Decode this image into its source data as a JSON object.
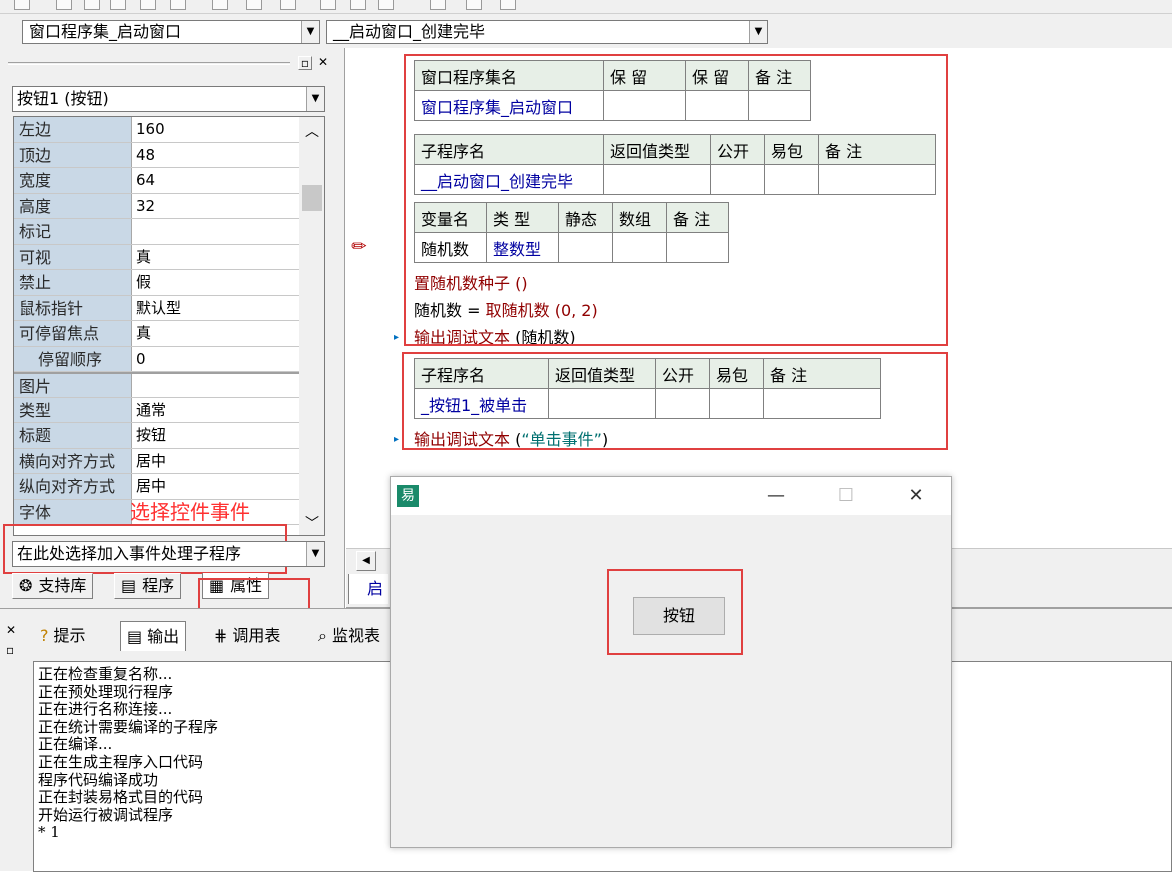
{
  "combos": {
    "assembly": "窗口程序集_启动窗口",
    "subroutine": "__启动窗口_创建完毕"
  },
  "properties": {
    "object": "按钮1 (按钮)",
    "rows": [
      {
        "name": "左边",
        "value": "160"
      },
      {
        "name": "顶边",
        "value": "48"
      },
      {
        "name": "宽度",
        "value": "64"
      },
      {
        "name": "高度",
        "value": "32"
      },
      {
        "name": "标记",
        "value": ""
      },
      {
        "name": "可视",
        "value": "真"
      },
      {
        "name": "禁止",
        "value": "假"
      },
      {
        "name": "鼠标指针",
        "value": "默认型"
      },
      {
        "name": "可停留焦点",
        "value": "真"
      },
      {
        "name": "停留顺序",
        "value": "0"
      },
      {
        "name": "图片",
        "value": ""
      },
      {
        "name": "类型",
        "value": "通常"
      },
      {
        "name": "标题",
        "value": "按钮"
      },
      {
        "name": "横向对齐方式",
        "value": "居中"
      },
      {
        "name": "纵向对齐方式",
        "value": "居中"
      },
      {
        "name": "字体",
        "value": ""
      }
    ],
    "event_combo": "在此处选择加入事件处理子程序",
    "select_hint": "选择控件事件"
  },
  "pane_tabs": {
    "support": "支持库",
    "program": "程序",
    "property": "属性"
  },
  "code": {
    "assembly_table": {
      "headers": [
        "窗口程序集名",
        "保 留",
        "保 留",
        "备 注"
      ],
      "row": [
        "窗口程序集_启动窗口",
        "",
        "",
        ""
      ]
    },
    "sub1_table": {
      "headers": [
        "子程序名",
        "返回值类型",
        "公开",
        "易包",
        "备 注"
      ],
      "row": [
        "__启动窗口_创建完毕",
        "",
        "",
        "",
        ""
      ]
    },
    "var_table": {
      "headers": [
        "变量名",
        "类 型",
        "静态",
        "数组",
        "备 注"
      ],
      "row": [
        "随机数",
        "整数型",
        "",
        "",
        ""
      ]
    },
    "lines": {
      "line1": "置随机数种子 ()",
      "line2_var": "随机数",
      "line2_op": " = ",
      "line2_func": "取随机数",
      "line2_args": " (0, 2)",
      "line3_func": "输出调试文本",
      "line3_args": " (随机数)"
    },
    "sub2_table": {
      "headers": [
        "子程序名",
        "返回值类型",
        "公开",
        "易包",
        "备 注"
      ],
      "row": [
        "_按钮1_被单击",
        "",
        "",
        "",
        ""
      ]
    },
    "line4_func": "输出调试文本",
    "line4_open": " (",
    "line4_str": "“单击事件”",
    "line4_close": ")"
  },
  "editor_tab": "启",
  "output_tabs": {
    "hint": "提示",
    "output": "输出",
    "call_table": "调用表",
    "monitor": "监视表"
  },
  "output_lines": [
    "正在检查重复名称...",
    "正在预处理现行程序",
    "正在进行名称连接...",
    "正在统计需要编译的子程序",
    "正在编译...",
    "正在生成主程序入口代码",
    "程序代码编译成功",
    "正在封装易格式目的代码",
    "开始运行被调试程序",
    "* 1"
  ],
  "app_window": {
    "icon": "易",
    "button_label": "按钮"
  },
  "colors": {
    "highlight_box": "#e04040",
    "prop_name_bg": "#c9d8e6",
    "code_header_bg": "#e7efe7",
    "keyword_blue": "#0000a0",
    "command_red": "#900000",
    "string_teal": "#007070"
  }
}
